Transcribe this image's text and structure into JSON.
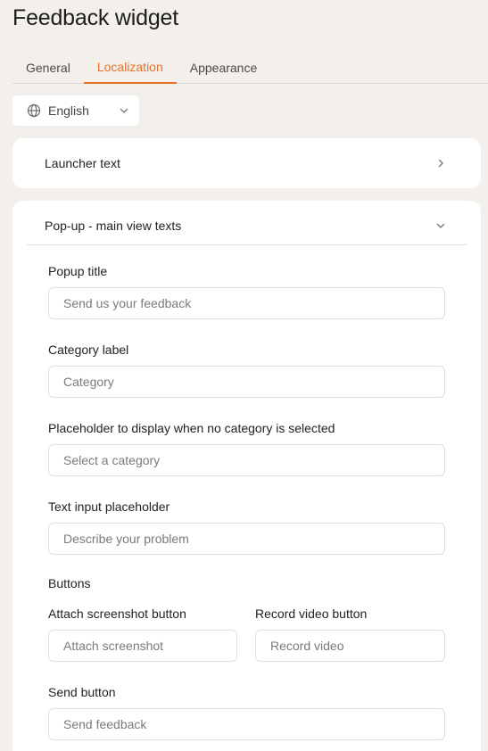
{
  "page": {
    "title": "Feedback widget"
  },
  "tabs": [
    {
      "label": "General"
    },
    {
      "label": "Localization"
    },
    {
      "label": "Appearance"
    }
  ],
  "language": {
    "selected": "English",
    "icon": "globe-icon"
  },
  "launcher": {
    "title": "Launcher text"
  },
  "popup": {
    "title": "Pop-up - main view texts",
    "fields": {
      "popup_title": {
        "label": "Popup title",
        "placeholder": "Send us your feedback"
      },
      "category_label": {
        "label": "Category label",
        "placeholder": "Category"
      },
      "no_category": {
        "label": "Placeholder to display when no category is selected",
        "placeholder": "Select a category"
      },
      "text_input": {
        "label": "Text input placeholder",
        "placeholder": "Describe your problem"
      },
      "buttons_heading": "Buttons",
      "attach_screenshot": {
        "label": "Attach screenshot button",
        "placeholder": "Attach screenshot"
      },
      "record_video": {
        "label": "Record video button",
        "placeholder": "Record video"
      },
      "send": {
        "label": "Send button",
        "placeholder": "Send feedback"
      }
    }
  },
  "colors": {
    "accent": "#e8712a",
    "background": "#f3f0eb",
    "card": "#ffffff"
  }
}
